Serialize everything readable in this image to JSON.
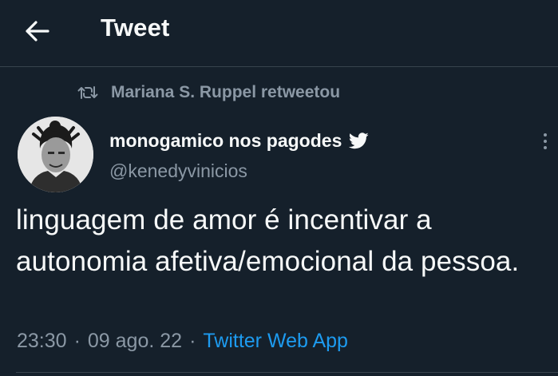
{
  "header": {
    "title": "Tweet",
    "back_icon": "arrow-left-icon"
  },
  "retweet": {
    "icon": "retweet-icon",
    "text": "Mariana S. Ruppel retweetou"
  },
  "author": {
    "display_name": "monogamico nos pagodes",
    "handle": "@kenedyvinicios",
    "badge_icon": "twitter-bird-icon"
  },
  "tweet": {
    "text": "linguagem de amor é incentivar a autonomia afetiva/emocional da pessoa.",
    "time": "23:30",
    "date": "09 ago. 22",
    "separator": "·",
    "source": "Twitter Web App"
  },
  "colors": {
    "background": "#15202b",
    "text": "#f7f9f9",
    "secondary": "#8b98a5",
    "accent": "#1d9bf0",
    "border": "#38444d"
  }
}
